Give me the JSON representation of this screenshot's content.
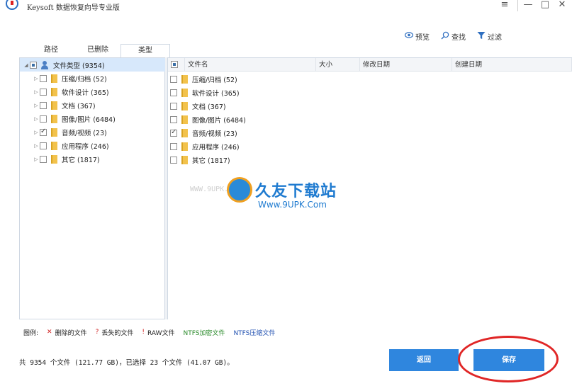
{
  "titlebar": {
    "title": "Keysoft 数据恢复向导专业版",
    "minimize": "—",
    "restore": "□",
    "close": "✕",
    "extra": "≡"
  },
  "toolbar": {
    "preview_label": "预览",
    "find_label": "查找",
    "filter_label": "过滤",
    "preview_icon": "eye-icon",
    "find_icon": "search-icon",
    "filter_icon": "funnel-icon"
  },
  "tabs": [
    {
      "label": "路径"
    },
    {
      "label": "已删除"
    },
    {
      "label": "类型",
      "active": true
    }
  ],
  "tree": {
    "root": {
      "label": "文件类型 (9354)"
    },
    "items": [
      {
        "label": "压缩/归档 (52)",
        "checked": false
      },
      {
        "label": "软件设计 (365)",
        "checked": false
      },
      {
        "label": "文档 (367)",
        "checked": false
      },
      {
        "label": "图像/图片 (6484)",
        "checked": false
      },
      {
        "label": "音频/视频 (23)",
        "checked": true
      },
      {
        "label": "应用程序 (246)",
        "checked": false
      },
      {
        "label": "其它 (1817)",
        "checked": false
      }
    ]
  },
  "file_list": {
    "columns": [
      "文件名",
      "大小",
      "修改日期",
      "创建日期"
    ],
    "rows": [
      {
        "name": "压缩/归档 (52)",
        "checked": false
      },
      {
        "name": "软件设计 (365)",
        "checked": false
      },
      {
        "name": "文档 (367)",
        "checked": false
      },
      {
        "name": "图像/图片 (6484)",
        "checked": false
      },
      {
        "name": "音频/视频 (23)",
        "checked": true
      },
      {
        "name": "应用程序 (246)",
        "checked": false
      },
      {
        "name": "其它 (1817)",
        "checked": false
      }
    ]
  },
  "watermark": {
    "left_url": "WWW.9UPK.COM",
    "title": "久友下载站",
    "url": "Www.9UPK.Com"
  },
  "legend": {
    "label": "图例:",
    "items": [
      {
        "mark": "✕",
        "text": "删除的文件",
        "color": "#d02020"
      },
      {
        "mark": "?",
        "text": "丢失的文件",
        "color": "#d02020"
      },
      {
        "mark": "!",
        "text": "RAW文件",
        "color": "#d02020"
      },
      {
        "mark": "",
        "text": "NTFS加密文件",
        "color": "#2a8a2a"
      },
      {
        "mark": "",
        "text": "NTFS压缩文件",
        "color": "#1f4fb0"
      }
    ]
  },
  "status": {
    "text": "共 9354 个文件 (121.77 GB)，已选择 23 个文件 (41.07 GB)。"
  },
  "buttons": {
    "back_label": "返回",
    "save_label": "保存"
  },
  "colors": {
    "accent": "#2f86de",
    "highlight_ring": "#e02626"
  }
}
